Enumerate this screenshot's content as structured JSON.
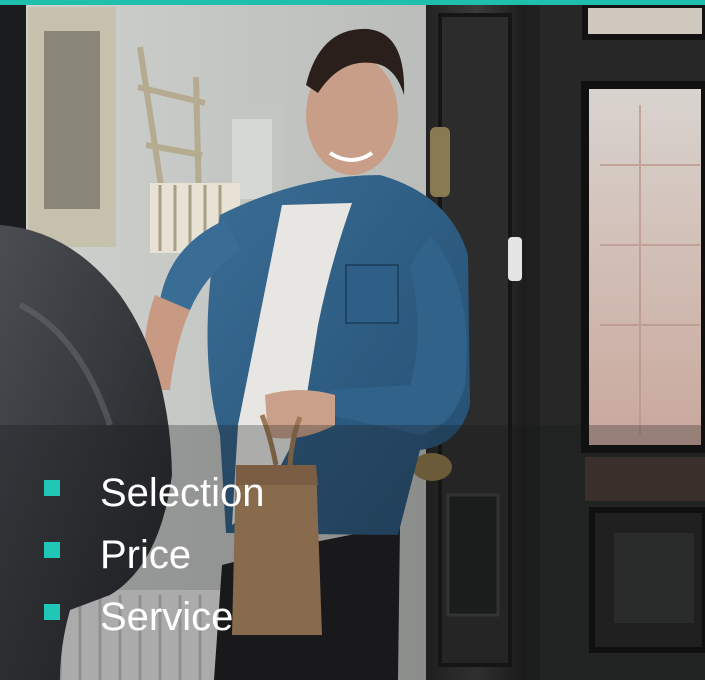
{
  "slide": {
    "accent_color": "#1fbfae",
    "bullet_color": "#21c7b6",
    "photo_description_icon": "delivery-photo",
    "bullets": [
      {
        "label": "Selection"
      },
      {
        "label": "Price"
      },
      {
        "label": "Service"
      }
    ]
  }
}
